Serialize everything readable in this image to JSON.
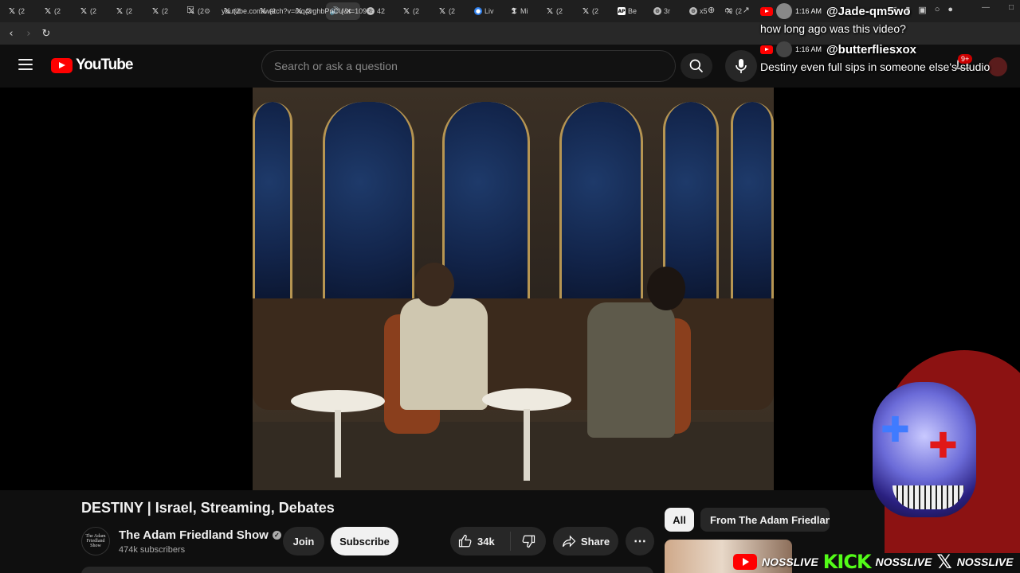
{
  "browser": {
    "tabs": [
      {
        "icon": "x",
        "label": "(2"
      },
      {
        "icon": "x",
        "label": "(2"
      },
      {
        "icon": "x",
        "label": "(2"
      },
      {
        "icon": "x",
        "label": "(2"
      },
      {
        "icon": "x",
        "label": "(2"
      },
      {
        "icon": "x",
        "label": "(2"
      },
      {
        "icon": "x",
        "label": "(2"
      },
      {
        "icon": "x",
        "label": "(2"
      },
      {
        "icon": "x",
        "label": "(2"
      },
      {
        "icon": "speaker",
        "label": "(",
        "active": true
      },
      {
        "icon": "globe",
        "label": "42"
      },
      {
        "icon": "x",
        "label": "(2"
      },
      {
        "icon": "x",
        "label": "(2"
      },
      {
        "icon": "blue",
        "label": "Liv"
      },
      {
        "icon": "nyt",
        "label": "Mi"
      },
      {
        "icon": "x",
        "label": "(2"
      },
      {
        "icon": "x",
        "label": "(2"
      },
      {
        "icon": "ap",
        "label": "Be"
      },
      {
        "icon": "globe",
        "label": "3r"
      },
      {
        "icon": "globe",
        "label": "x5"
      },
      {
        "icon": "x",
        "label": "(2"
      }
    ],
    "url": "youtube.com/watch?v=mq4vghbPnCU&t=1095s"
  },
  "header": {
    "logo_text": "YouTube",
    "search_placeholder": "Search or ask a question",
    "notif_count": "9+"
  },
  "chat": [
    {
      "time": "1:16 AM",
      "user": "@Jade-qm5wo",
      "text": "how long ago was this video?"
    },
    {
      "time": "1:16 AM",
      "user": "@butterfliesxox",
      "text": "Destiny even full sips in someone else's studio"
    }
  ],
  "video": {
    "title": "DESTINY | Israel, Streaming, Debates",
    "channel": "The Adam Friedland Show",
    "channel_avatar_text": "The Adam Friedland Show",
    "subscribers": "474k subscribers",
    "join_label": "Join",
    "subscribe_label": "Subscribe",
    "likes": "34k",
    "share_label": "Share"
  },
  "rail": {
    "chips": [
      "All",
      "From The Adam Friedland Show"
    ]
  },
  "overlay": {
    "yt_name": "NOSSLIVE",
    "kick_logo": "KICK",
    "kick_name": "NOSSLIVE",
    "x_name": "NOSSLIVE"
  }
}
